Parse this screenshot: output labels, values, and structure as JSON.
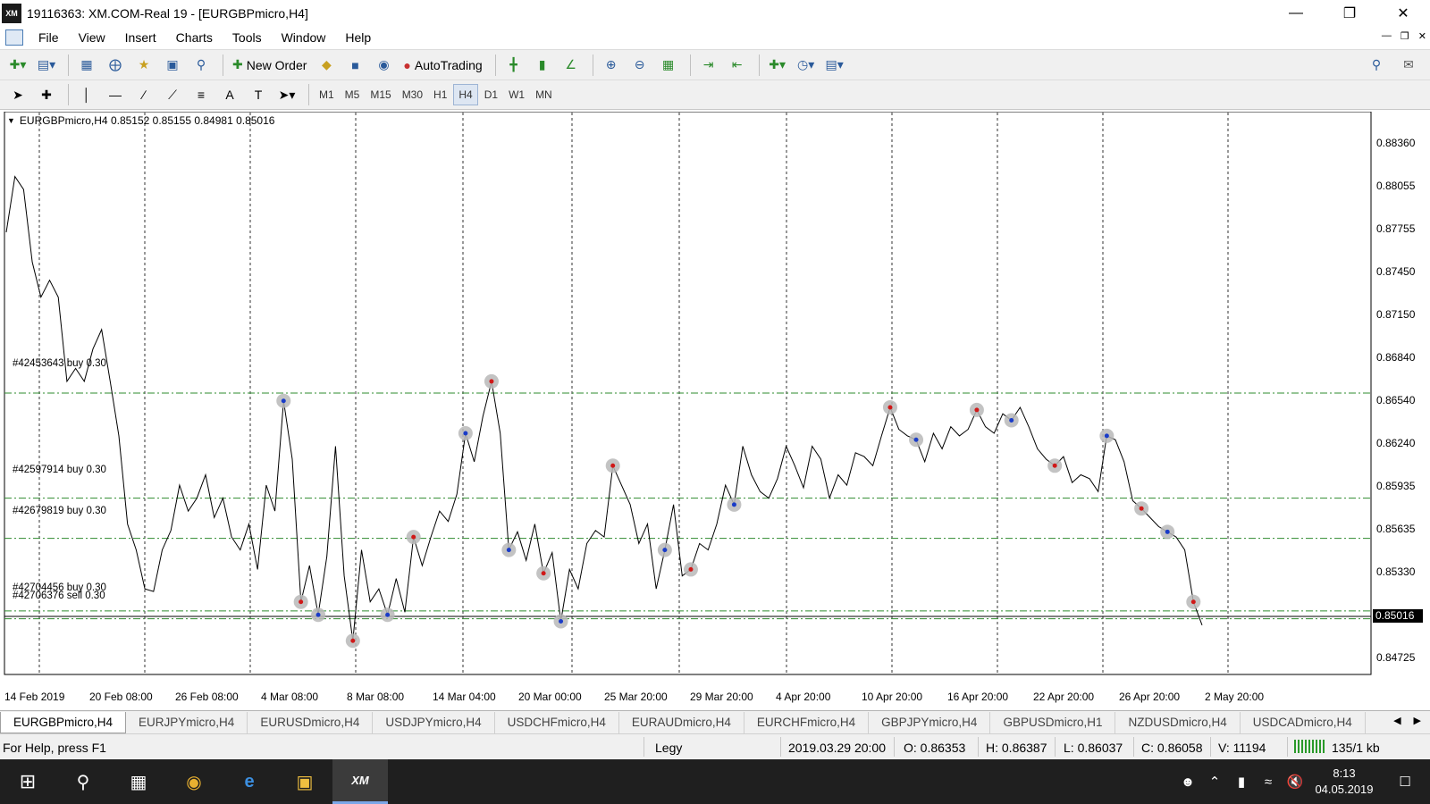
{
  "window": {
    "title": "19116363: XM.COM-Real 19 - [EURGBPmicro,H4]",
    "logo": "XM"
  },
  "menu": [
    "File",
    "View",
    "Insert",
    "Charts",
    "Tools",
    "Window",
    "Help"
  ],
  "toolbar": {
    "new_order": "New Order",
    "auto_trading": "AutoTrading"
  },
  "timeframes": [
    "M1",
    "M5",
    "M15",
    "M30",
    "H1",
    "H4",
    "D1",
    "W1",
    "MN"
  ],
  "active_timeframe": "H4",
  "chart": {
    "header": "EURGBPmicro,H4  0.85152 0.85155 0.84981 0.85016",
    "current_price": "0.85016",
    "price_labels": [
      "0.88360",
      "0.88055",
      "0.87755",
      "0.87450",
      "0.87150",
      "0.86840",
      "0.86540",
      "0.86240",
      "0.85935",
      "0.85635",
      "0.85330",
      "0.84725"
    ],
    "time_labels": [
      "14 Feb 2019",
      "20 Feb 08:00",
      "26 Feb 08:00",
      "4 Mar 08:00",
      "8 Mar 08:00",
      "14 Mar 04:00",
      "20 Mar 00:00",
      "25 Mar 20:00",
      "29 Mar 20:00",
      "4 Apr 20:00",
      "10 Apr 20:00",
      "16 Apr 20:00",
      "22 Apr 20:00",
      "26 Apr 20:00",
      "2 May 20:00"
    ],
    "orders": [
      "#42453643 buy 0.30",
      "#42597914 buy 0.30",
      "#42679819 buy 0.30",
      "#42704456 buy 0.30",
      "#42706376 sell 0.30"
    ]
  },
  "chart_data": {
    "type": "line",
    "symbol": "EURGBPmicro",
    "timeframe": "H4",
    "ylim": [
      0.8464,
      0.8898
    ],
    "order_levels": [
      0.8681,
      0.86,
      0.8569,
      0.8513,
      0.8507
    ],
    "close": [
      0.8805,
      0.8848,
      0.8838,
      0.8782,
      0.8755,
      0.8768,
      0.8755,
      0.869,
      0.87,
      0.869,
      0.8715,
      0.873,
      0.869,
      0.8648,
      0.858,
      0.856,
      0.853,
      0.8528,
      0.856,
      0.8575,
      0.861,
      0.859,
      0.86,
      0.8618,
      0.8585,
      0.86,
      0.857,
      0.856,
      0.858,
      0.8545,
      0.861,
      0.859,
      0.8675,
      0.863,
      0.852,
      0.8548,
      0.851,
      0.8555,
      0.864,
      0.854,
      0.849,
      0.856,
      0.852,
      0.853,
      0.851,
      0.8538,
      0.8512,
      0.857,
      0.8548,
      0.857,
      0.859,
      0.8582,
      0.8603,
      0.865,
      0.8628,
      0.8663,
      0.869,
      0.865,
      0.856,
      0.8574,
      0.8552,
      0.858,
      0.8542,
      0.8558,
      0.8505,
      0.8545,
      0.853,
      0.8565,
      0.8575,
      0.857,
      0.8625,
      0.861,
      0.8595,
      0.8565,
      0.858,
      0.853,
      0.856,
      0.8595,
      0.854,
      0.8545,
      0.8565,
      0.856,
      0.858,
      0.861,
      0.8595,
      0.864,
      0.8618,
      0.8605,
      0.86,
      0.8615,
      0.864,
      0.8625,
      0.8608,
      0.864,
      0.863,
      0.86,
      0.8618,
      0.861,
      0.8635,
      0.8632,
      0.8625,
      0.8648,
      0.867,
      0.8653,
      0.8648,
      0.8645,
      0.8628,
      0.865,
      0.8638,
      0.8655,
      0.8648,
      0.8653,
      0.8668,
      0.8655,
      0.865,
      0.8665,
      0.866,
      0.867,
      0.8655,
      0.8638,
      0.863,
      0.8625,
      0.8632,
      0.8612,
      0.8618,
      0.8615,
      0.8605,
      0.8648,
      0.8645,
      0.8628,
      0.8598,
      0.8592,
      0.8585,
      0.8578,
      0.8574,
      0.857,
      0.856,
      0.852,
      0.8502
    ]
  },
  "symbol_tabs": [
    "EURGBPmicro,H4",
    "EURJPYmicro,H4",
    "EURUSDmicro,H4",
    "USDJPYmicro,H4",
    "USDCHFmicro,H4",
    "EURAUDmicro,H4",
    "EURCHFmicro,H4",
    "GBPJPYmicro,H4",
    "GBPUSDmicro,H1",
    "NZDUSDmicro,H4",
    "USDCADmicro,H4"
  ],
  "active_tab": "EURGBPmicro,H4",
  "status": {
    "help": "For Help, press F1",
    "profile": "Legy",
    "datetime": "2019.03.29 20:00",
    "open": "O: 0.86353",
    "high": "H: 0.86387",
    "low": "L: 0.86037",
    "close": "C: 0.86058",
    "volume": "V: 11194",
    "connection": "135/1 kb"
  },
  "taskbar": {
    "time": "8:13",
    "date": "04.05.2019",
    "xm_label": "XM"
  },
  "colors": {
    "order_line": "#2e8b2e",
    "price_line": "#000000",
    "buy_arrow": "#1a3cc8",
    "sell_arrow": "#d01818",
    "grid": "#000000"
  }
}
